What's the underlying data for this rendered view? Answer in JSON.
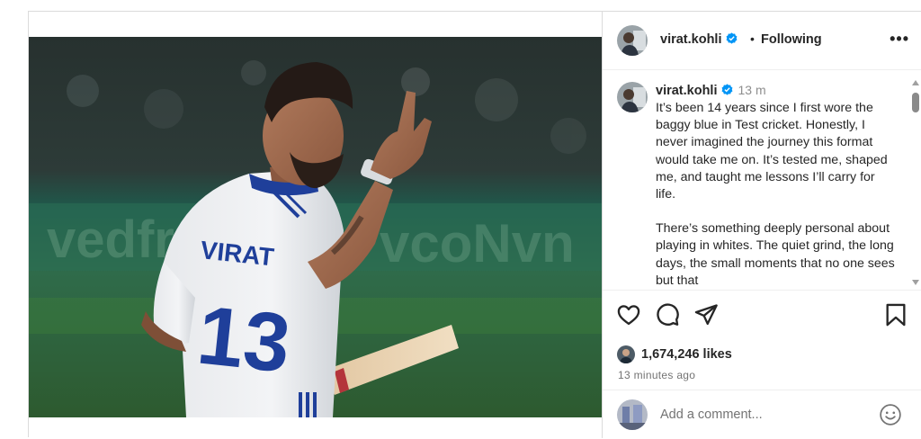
{
  "post": {
    "username": "virat.kohli",
    "follow_status": "Following",
    "more_label": "•••",
    "separator": "•",
    "caption": {
      "username": "virat.kohli",
      "time": "13 m",
      "paragraphs": [
        "It’s been 14 years since I first wore the baggy blue in Test cricket. Honestly, I never imagined the journey this format would take me on. It’s tested me, shaped me, and taught me lessons I’ll carry for life.",
        "There’s something deeply personal about playing in whites. The quiet grind, the long days, the small moments that no one sees but that"
      ]
    },
    "likes": "1,674,246 likes",
    "time_ago": "13 minutes ago",
    "comment_placeholder": "Add a comment...",
    "photo": {
      "jersey_name": "VIRAT",
      "jersey_number": "13"
    }
  },
  "icons": {
    "verified": "verified-badge-icon",
    "like": "heart-icon",
    "comment": "comment-icon",
    "share": "share-icon",
    "save": "bookmark-icon",
    "emoji": "emoji-icon"
  },
  "colors": {
    "verified": "#0095f6",
    "text": "#262626",
    "secondary": "#737373",
    "border": "#dbdbdb"
  }
}
